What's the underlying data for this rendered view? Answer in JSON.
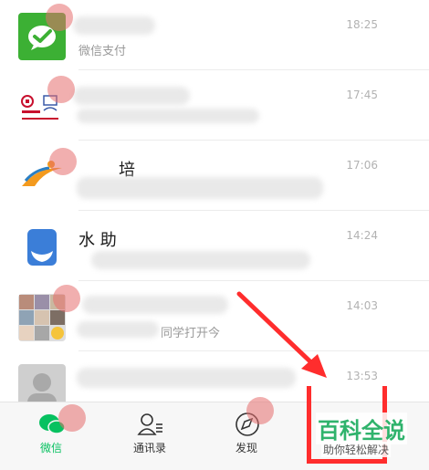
{
  "chats": [
    {
      "title": "",
      "preview": "微信支付",
      "time": "18:25",
      "avatar_icon": "wechat-pay-icon"
    },
    {
      "title": "",
      "preview": "",
      "time": "17:45",
      "avatar_icon": "bank-logo-icon"
    },
    {
      "title": "培",
      "preview": "",
      "time": "17:06",
      "avatar_icon": "orange-swoosh-logo-icon"
    },
    {
      "title": "水 助",
      "preview": "",
      "time": "14:24",
      "avatar_icon": "water-drop-logo-icon"
    },
    {
      "title": "",
      "preview": "同学打开今",
      "time": "14:03",
      "avatar_icon": "group-avatar-icon"
    },
    {
      "title": "",
      "preview": "",
      "time": "13:53",
      "avatar_icon": "person-avatar-icon"
    }
  ],
  "tabs": [
    {
      "label": "微信",
      "icon": "chat-bubbles-icon",
      "active": true
    },
    {
      "label": "通讯录",
      "icon": "contacts-icon",
      "active": false
    },
    {
      "label": "发现",
      "icon": "compass-icon",
      "active": false
    }
  ],
  "watermark": {
    "title": "百科全说",
    "subtitle": "助你轻松解决"
  },
  "colors": {
    "accent": "#07c160",
    "annotation": "#ff2d2d",
    "watermark": "#2fb36c"
  }
}
